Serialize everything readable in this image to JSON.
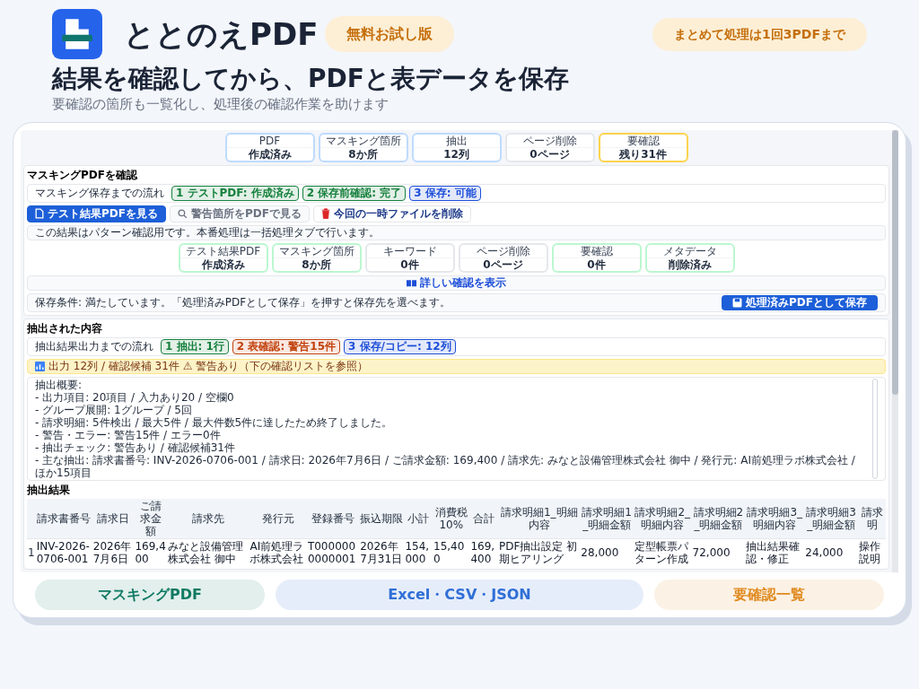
{
  "app": {
    "name": "ととのえPDF",
    "badges": [
      {
        "label": "無料お試し版"
      },
      {
        "label": "まとめて処理は1回3PDFまで"
      }
    ]
  },
  "headline": "結果を確認してから、PDFと表データを保存",
  "subheadline": "要確認の箇所も一覧化し、処理後の確認作業を助けます",
  "screenshot": {
    "top_stats": [
      {
        "label": "PDF",
        "value": "作成済み",
        "color": "#bfdbfe"
      },
      {
        "label": "マスキング箇所",
        "value": "8か所",
        "color": "#bfdbfe"
      },
      {
        "label": "抽出",
        "value": "12列",
        "color": "#bfdbfe"
      },
      {
        "label": "ページ削除",
        "value": "0ページ",
        "color": "#e5e7eb"
      },
      {
        "label": "要確認",
        "value": "残り31件",
        "color": "#fcd34d"
      }
    ],
    "masking": {
      "title": "マスキングPDFを確認",
      "flow_label": "マスキング保存までの流れ",
      "flow": [
        {
          "label": "1 テストPDF: 作成済み",
          "color": "#15803d"
        },
        {
          "label": "2 保存前確認: 完了",
          "color": "#15803d"
        },
        {
          "label": "3 保存: 可能",
          "color": "#1d4ed8"
        }
      ],
      "buttons": [
        {
          "label": "テスト結果PDFを見る",
          "kind": "primary",
          "disabled": false
        },
        {
          "label": "警告箇所をPDFで見る",
          "kind": "search",
          "disabled": true
        },
        {
          "label": "今回の一時ファイルを削除",
          "kind": "delete",
          "disabled": false
        }
      ],
      "note": "この結果はパターン確認用です。本番処理は一括処理タブで行います。",
      "stats": [
        {
          "label": "テスト結果PDF",
          "value": "作成済み",
          "color": "#bbf7d0"
        },
        {
          "label": "マスキング箇所",
          "value": "8か所",
          "color": "#bbf7d0"
        },
        {
          "label": "キーワード",
          "value": "0件",
          "color": "#e5e7eb"
        },
        {
          "label": "ページ削除",
          "value": "0ページ",
          "color": "#e5e7eb"
        },
        {
          "label": "要確認",
          "value": "0件",
          "color": "#bbf7d0"
        },
        {
          "label": "メタデータ",
          "value": "削除済み",
          "color": "#bbf7d0"
        }
      ],
      "details_link": "詳しい確認を表示",
      "save_note": "保存条件: 満たしています。「処理済みPDFとして保存」を押すと保存先を選べます。",
      "save_button": "処理済みPDFとして保存"
    },
    "extraction": {
      "title": "抽出された内容",
      "flow_label": "抽出結果出力までの流れ",
      "flow": [
        {
          "label": "1 抽出: 1行",
          "color": "#15803d"
        },
        {
          "label": "2 表確認: 警告15件",
          "color": "#c2410c"
        },
        {
          "label": "3 保存/コピー: 12列",
          "color": "#1d4ed8"
        }
      ],
      "alert": "出力 12列 / 確認候補 31件 ⚠ 警告あり（下の確認リストを参照）",
      "summary_lines": [
        "抽出概要:",
        "- 出力項目: 20項目 / 入力あり20 / 空欄0",
        "- グループ展開: 1グループ / 5回",
        "- 請求明細: 5件検出 / 最大5件 / 最大件数5件に達したため終了しました。",
        "- 警告・エラー: 警告15件 / エラー0件",
        "- 抽出チェック: 警告あり / 確認候補31件",
        "- 主な抽出: 請求書番号: INV-2026-0706-001 / 請求日: 2026年7月6日 / ご請求金額: 169,400 / 請求先: みなと設備管理株式会社 御中 / 発行元: AI前処理ラボ株式会社 / ほか15項目"
      ],
      "table": {
        "title": "抽出結果",
        "columns": [
          "請求書番号",
          "請求日",
          "ご請求金額",
          "請求先",
          "発行元",
          "登録番号",
          "振込期限",
          "小計",
          "消費税10%",
          "合計",
          "請求明細1_明細内容",
          "請求明細1_明細金額",
          "請求明細2_明細内容",
          "請求明細2_明細金額",
          "請求明細3_明細内容",
          "請求明細3_明細金額",
          "請求明"
        ],
        "rows": [
          {
            "index": "1",
            "cells": [
              "INV-2026-0706-001",
              "2026年7月6日",
              "169,400",
              "みなと設備管理株式会社 御中",
              "AI前処理ラボ株式会社",
              "T0000000000001",
              "2026年7月31日",
              "154,000",
              "15,400",
              "169,400",
              "PDF抽出設定 初期ヒアリング",
              "28,000",
              "定型帳票パターン作成",
              "72,000",
              "抽出結果確認・修正",
              "24,000",
              "操作説明"
            ]
          }
        ]
      }
    }
  },
  "features": [
    {
      "label": "マスキングPDF",
      "color": "#0f7a63"
    },
    {
      "label": "Excel・CSV・JSON",
      "color": "#2f6fd6"
    },
    {
      "label": "要確認一覧",
      "color": "#e08a1e"
    }
  ]
}
